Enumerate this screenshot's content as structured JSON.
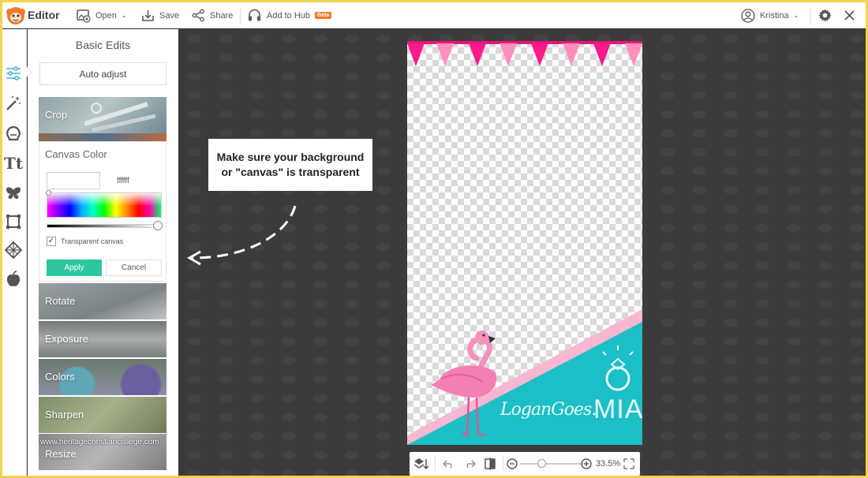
{
  "app": {
    "name": "Editor",
    "brand_color": "#f07a2a"
  },
  "toolbar": {
    "open_label": "Open",
    "save_label": "Save",
    "share_label": "Share",
    "hub_label": "Add to Hub",
    "beta_label": "Beta",
    "user_name": "Kristina"
  },
  "panel": {
    "title": "Basic Edits",
    "auto_adjust_label": "Auto adjust",
    "tiles": [
      {
        "label": "Crop"
      },
      {
        "label": "Rotate"
      },
      {
        "label": "Exposure"
      },
      {
        "label": "Colors"
      },
      {
        "label": "Sharpen"
      },
      {
        "label": "Resize"
      }
    ],
    "canvas_color": {
      "title": "Canvas Color",
      "hex_value": "ffffff",
      "transparent_label": "Transparent canvas",
      "transparent_checked": true,
      "apply_label": "Apply",
      "cancel_label": "Cancel",
      "apply_color": "#2ec6a0"
    }
  },
  "watermark": "www.heritagechristiancollege.com",
  "callout": {
    "line1": "Make sure your background",
    "line2": "or \"canvas\" is transparent"
  },
  "design": {
    "text_logan": "LoganGoes.",
    "text_mia": "MIA",
    "pink": "#ff1a8c",
    "teal": "#1cbfc6"
  },
  "zoom": {
    "value": "33.5%"
  }
}
